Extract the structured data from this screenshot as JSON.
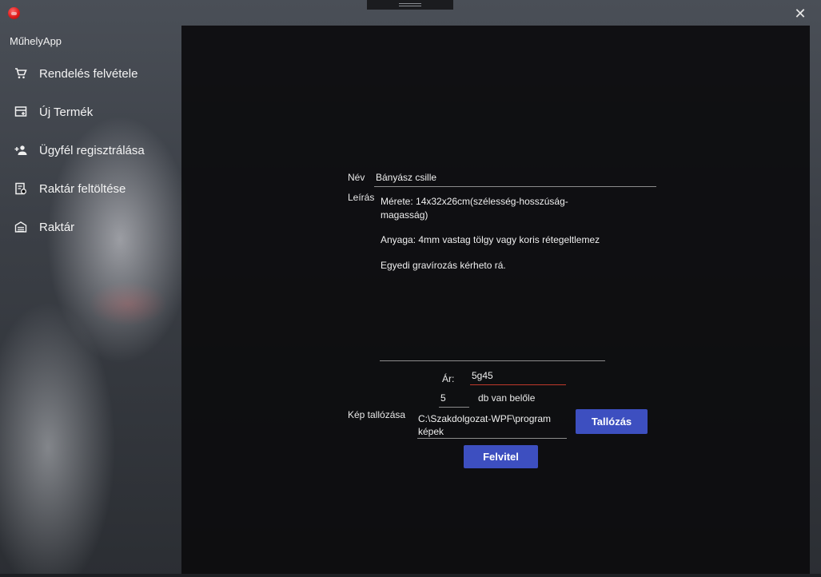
{
  "app": {
    "title": "MűhelyApp"
  },
  "window": {
    "close_glyph": "✕"
  },
  "sidebar": {
    "items": [
      {
        "label": "Rendelés felvétele",
        "icon": "cart-icon"
      },
      {
        "label": "Új Termék",
        "icon": "new-product-icon"
      },
      {
        "label": "Ügyfél regisztrálása",
        "icon": "add-user-icon"
      },
      {
        "label": "Raktár feltöltése",
        "icon": "stock-upload-icon"
      },
      {
        "label": "Raktár",
        "icon": "warehouse-icon"
      }
    ]
  },
  "form": {
    "name_label": "Név",
    "name_value": "Bányász csille",
    "desc_label": "Leírás",
    "desc_lines": [
      "Mérete: 14x32x26cm(szélesség-hosszúság-",
      "magasság)",
      "Anyaga: 4mm vastag tölgy vagy koris rétegeltlemez",
      "Egyedi gravírozás kérheto rá."
    ],
    "price_label": "Ár:",
    "price_value": "5g45",
    "quantity_value": "5",
    "quantity_suffix": "db van belőle",
    "image_label": "Kép tallózása",
    "image_path_line1": "C:\\Szakdolgozat-WPF\\program",
    "image_path_line2": "képek",
    "browse_button": "Tallózás",
    "submit_button": "Felvitel"
  },
  "colors": {
    "accent": "#3d4fc0",
    "error_underline": "#c0392b",
    "content_bg": "#0c0c0e"
  }
}
